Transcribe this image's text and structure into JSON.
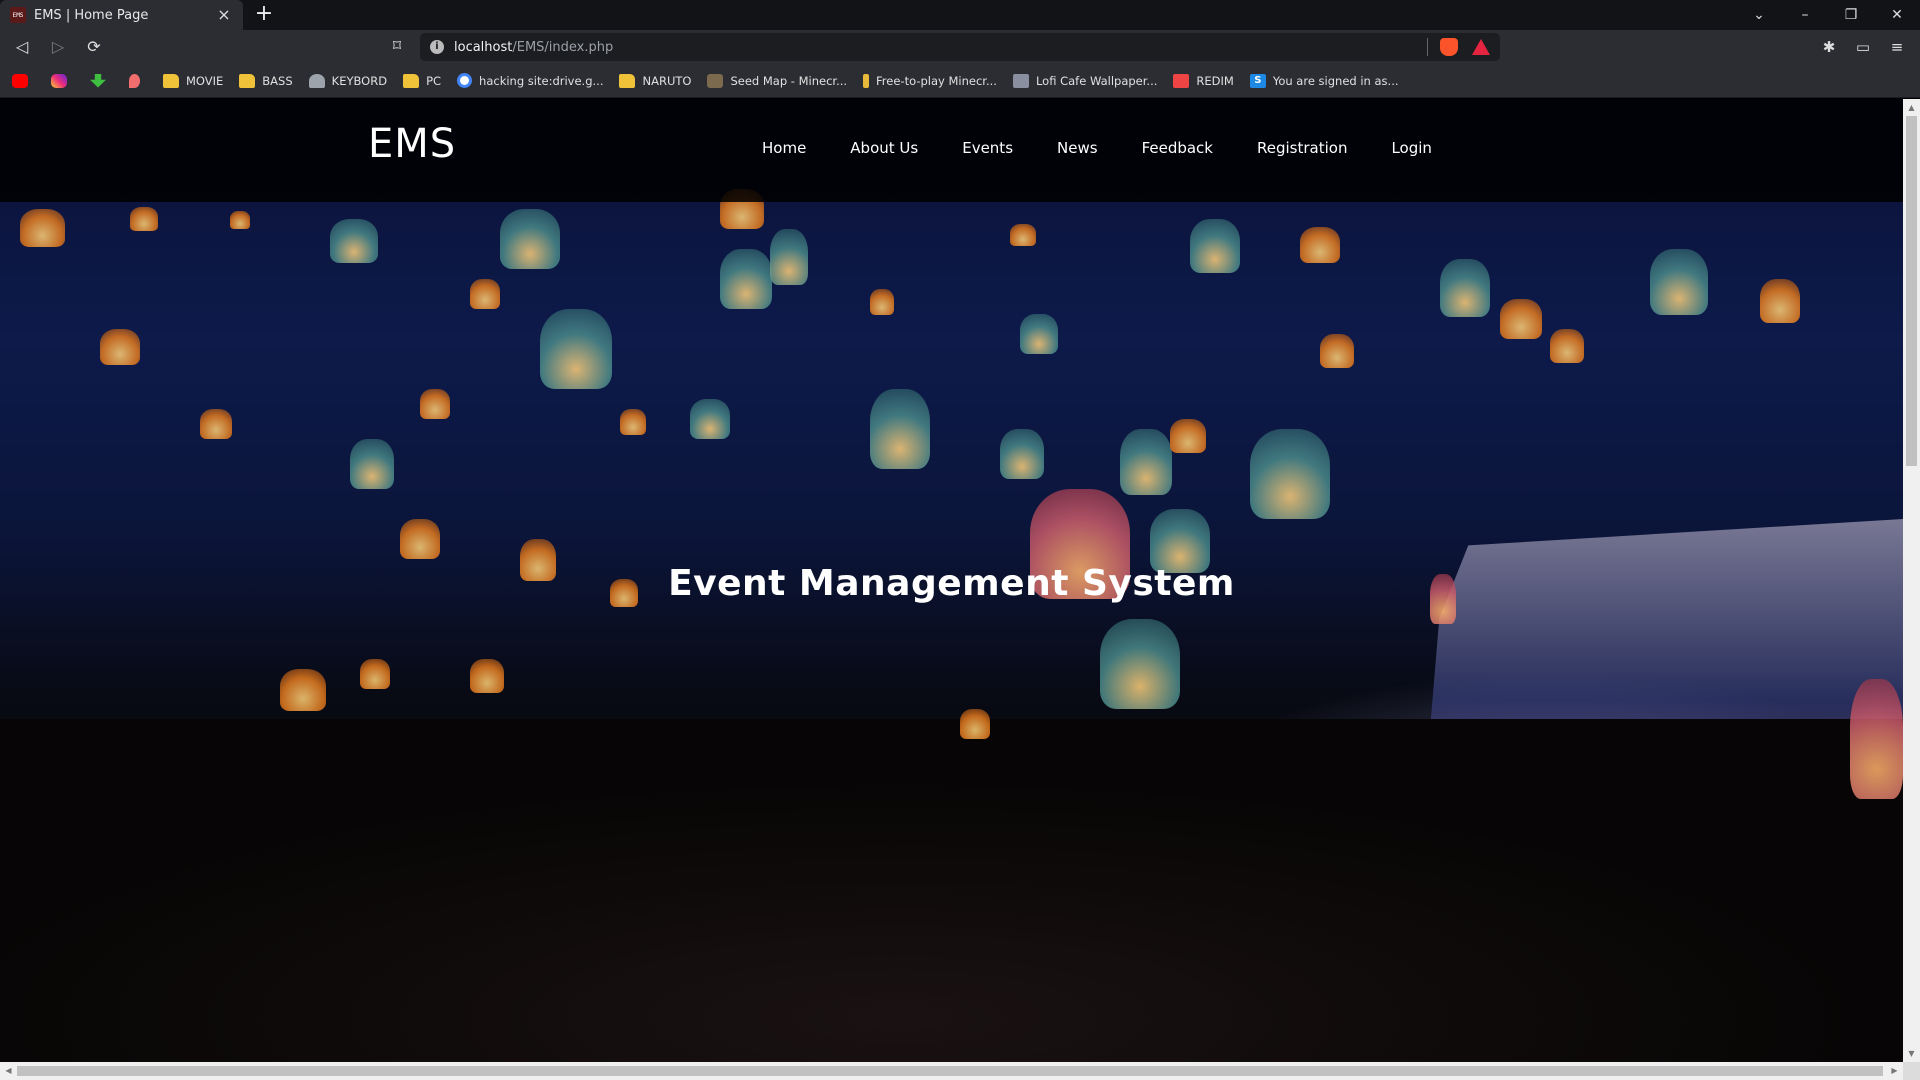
{
  "browser": {
    "tab": {
      "favicon_text": "EMS",
      "title": "EMS | Home Page",
      "close": "×"
    },
    "new_tab": "+",
    "window_controls": [
      "⌄",
      "–",
      "❐",
      "✕"
    ],
    "nav": {
      "back": "◁",
      "forward": "▷",
      "reload": "⟳",
      "bookmark": "⌑"
    },
    "url": {
      "host": "localhost",
      "path": "/EMS/index.php"
    },
    "right_controls": [
      "✱",
      "▭",
      "≡"
    ],
    "bookmarks": [
      {
        "label": "",
        "icon": "youtube-icon"
      },
      {
        "label": "",
        "icon": "instagram-icon"
      },
      {
        "label": "",
        "icon": "download-icon"
      },
      {
        "label": "",
        "icon": "pin-icon"
      },
      {
        "label": "MOVIE",
        "icon": "folder-icon"
      },
      {
        "label": "BASS",
        "icon": "folder-icon"
      },
      {
        "label": "KEYBORD",
        "icon": "keyboard-site-icon"
      },
      {
        "label": "PC",
        "icon": "folder-icon"
      },
      {
        "label": "hacking site:drive.g...",
        "icon": "google-icon"
      },
      {
        "label": "NARUTO",
        "icon": "folder-icon"
      },
      {
        "label": "Seed Map - Minecr...",
        "icon": "seed-map-icon"
      },
      {
        "label": "Free-to-play Minecr...",
        "icon": "minecraft-icon"
      },
      {
        "label": "Lofi Cafe Wallpaper...",
        "icon": "lofi-icon"
      },
      {
        "label": "REDIM",
        "icon": "redim-icon"
      },
      {
        "label": "You are signed in as...",
        "icon": "s-icon"
      }
    ]
  },
  "site": {
    "logo": "EMS",
    "nav": [
      "Home",
      "About Us",
      "Events",
      "News",
      "Feedback",
      "Registration",
      "Login"
    ],
    "hero_title": "Event Management System"
  },
  "colors": {
    "header_bg": "#000000",
    "hero_text": "#ffffff",
    "chrome_bg": "#2b2d33",
    "tabbar_bg": "#121316"
  }
}
